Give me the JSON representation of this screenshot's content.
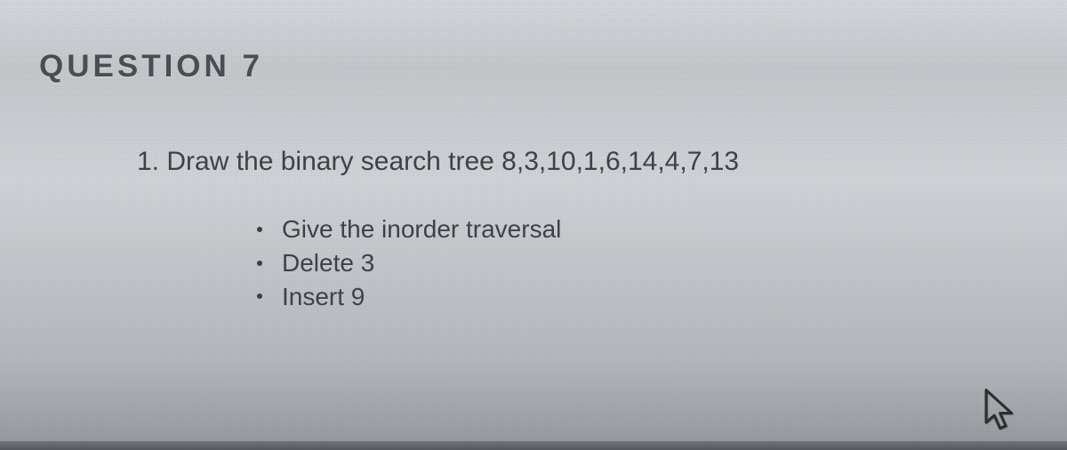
{
  "question": {
    "title": "QUESTION 7",
    "prompt": "1. Draw the binary search tree 8,3,10,1,6,14,4,7,13",
    "subitems": [
      "Give the inorder traversal",
      "Delete 3",
      "Insert 9"
    ]
  }
}
